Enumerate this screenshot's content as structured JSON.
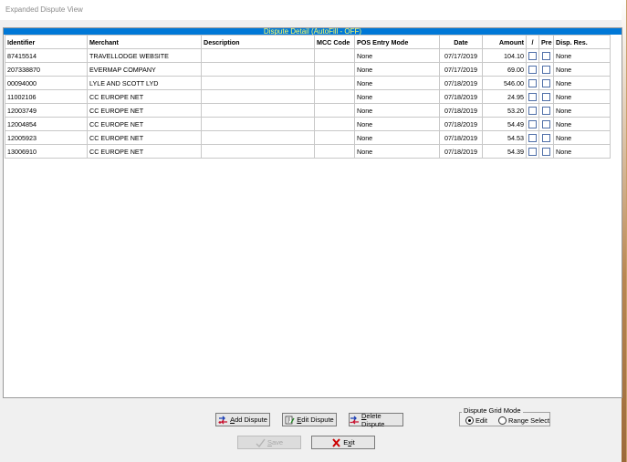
{
  "window": {
    "title": "Expanded Dispute View"
  },
  "panel": {
    "header": "Dispute Detail (AutoFill - OFF)"
  },
  "table": {
    "columns": [
      "Identifier",
      "Merchant",
      "Description",
      "MCC Code",
      "POS Entry Mode",
      "Date",
      "Amount",
      "/",
      "Pre",
      "Disp. Res."
    ],
    "rows": [
      {
        "identifier": "87415514",
        "merchant": "TRAVELLODGE WEBSITE",
        "description": "",
        "mcc": "",
        "pos": "None",
        "date": "07/17/2019",
        "amount": "104.10",
        "disp_res": "None"
      },
      {
        "identifier": "207338870",
        "merchant": "EVERMAP COMPANY",
        "description": "",
        "mcc": "",
        "pos": "None",
        "date": "07/17/2019",
        "amount": "69.00",
        "disp_res": "None"
      },
      {
        "identifier": "00094000",
        "merchant": "LYLE AND SCOTT LYD",
        "description": "",
        "mcc": "",
        "pos": "None",
        "date": "07/18/2019",
        "amount": "546.00",
        "disp_res": "None"
      },
      {
        "identifier": "11002106",
        "merchant": "CC EUROPE NET",
        "description": "",
        "mcc": "",
        "pos": "None",
        "date": "07/18/2019",
        "amount": "24.95",
        "disp_res": "None"
      },
      {
        "identifier": "12003749",
        "merchant": "CC EUROPE NET",
        "description": "",
        "mcc": "",
        "pos": "None",
        "date": "07/18/2019",
        "amount": "53.20",
        "disp_res": "None"
      },
      {
        "identifier": "12004854",
        "merchant": "CC EUROPE NET",
        "description": "",
        "mcc": "",
        "pos": "None",
        "date": "07/18/2019",
        "amount": "54.49",
        "disp_res": "None"
      },
      {
        "identifier": "12005923",
        "merchant": "CC EUROPE NET",
        "description": "",
        "mcc": "",
        "pos": "None",
        "date": "07/18/2019",
        "amount": "54.53",
        "disp_res": "None"
      },
      {
        "identifier": "13006910",
        "merchant": "CC EUROPE NET",
        "description": "",
        "mcc": "",
        "pos": "None",
        "date": "07/18/2019",
        "amount": "54.39",
        "disp_res": "None"
      }
    ]
  },
  "buttons": {
    "add_u": "A",
    "add_rest": "dd Dispute",
    "edit_u": "E",
    "edit_rest": "dit Dispute",
    "delete_u": "D",
    "delete_rest": "elete Dispute",
    "save_u": "S",
    "save_rest": "ave",
    "exit_first": "E",
    "exit_u": "x",
    "exit_rest": "it"
  },
  "mode": {
    "title": "Dispute Grid Mode",
    "options": [
      "Edit",
      "Range Select"
    ],
    "selected": "Edit"
  },
  "colors": {
    "header_bar": "#0078d7",
    "header_text": "#ffff66",
    "exit_icon": "#cc0000"
  }
}
